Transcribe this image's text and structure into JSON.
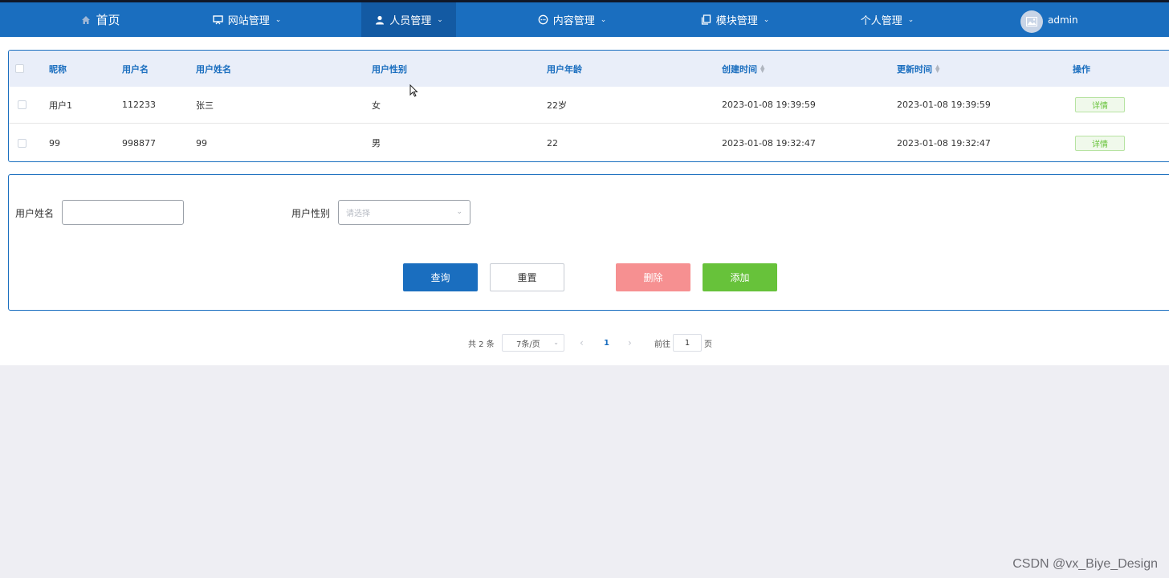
{
  "nav": {
    "items": [
      {
        "label": "首页",
        "icon": "home-icon",
        "has_dropdown": false
      },
      {
        "label": "网站管理",
        "icon": "presentation-icon",
        "has_dropdown": true
      },
      {
        "label": "人员管理",
        "icon": "user-icon",
        "has_dropdown": true,
        "active": true
      },
      {
        "label": "内容管理",
        "icon": "chat-icon",
        "has_dropdown": true
      },
      {
        "label": "模块管理",
        "icon": "copy-icon",
        "has_dropdown": true
      },
      {
        "label": "个人管理",
        "icon": "",
        "has_dropdown": true
      }
    ],
    "user": {
      "name": "admin",
      "avatar_icon": "image-icon"
    },
    "colors": {
      "bar": "#1a6ebf",
      "active": "#135aa3"
    }
  },
  "table": {
    "headers": [
      "昵称",
      "用户名",
      "用户姓名",
      "用户性别",
      "用户年龄",
      "创建时间",
      "更新时间",
      "操作"
    ],
    "rows": [
      {
        "nickname": "用户1",
        "username": "112233",
        "realname": "张三",
        "gender": "女",
        "age": "22岁",
        "created": "2023-01-08 19:39:59",
        "updated": "2023-01-08 19:39:59",
        "action": "详情"
      },
      {
        "nickname": "99",
        "username": "998877",
        "realname": "99",
        "gender": "男",
        "age": "22",
        "created": "2023-01-08 19:32:47",
        "updated": "2023-01-08 19:32:47",
        "action": "详情"
      }
    ]
  },
  "search": {
    "name_label": "用户姓名",
    "name_value": "",
    "gender_label": "用户性别",
    "gender_placeholder": "请选择",
    "buttons": {
      "query": "查询",
      "reset": "重置",
      "delete": "删除",
      "add": "添加"
    }
  },
  "pagination": {
    "total": "共 2 条",
    "page_size": "7条/页",
    "current_page": "1",
    "goto_label": "前往",
    "goto_value": "1",
    "page_suffix": "页"
  },
  "watermark": "CSDN @vx_Biye_Design"
}
